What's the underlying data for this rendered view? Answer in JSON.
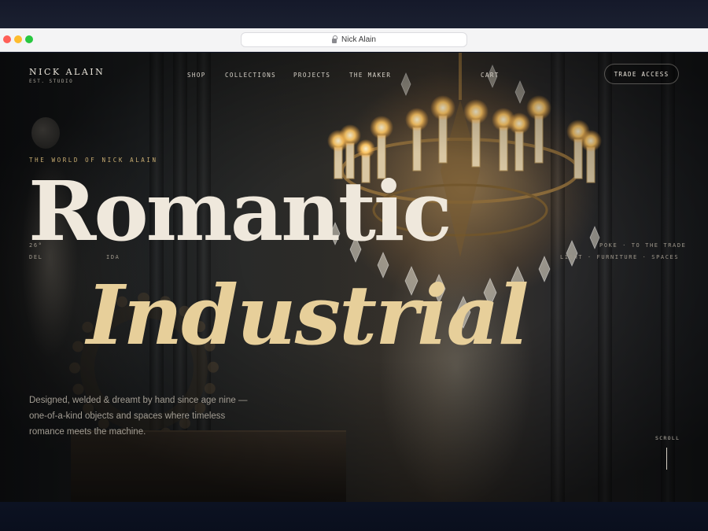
{
  "browser": {
    "address_text": "Nick Alain"
  },
  "brand": {
    "name": "NICK ALAIN",
    "tagline": "EST. STUDIO"
  },
  "nav": {
    "items": [
      {
        "label": "SHOP"
      },
      {
        "label": "COLLECTIONS"
      },
      {
        "label": "PROJECTS"
      },
      {
        "label": "THE MAKER"
      },
      {
        "label": "CART"
      }
    ],
    "trade_button": "TRADE ACCESS"
  },
  "hero": {
    "eyebrow": "THE WORLD OF NICK ALAIN",
    "headline_line1": "Romantic",
    "headline_line2": "Industrial",
    "meta_left_1": "26°",
    "meta_left_2": "DEL",
    "meta_left_3": "IDA",
    "meta_right_1": "POKE · TO THE TRADE",
    "meta_right_2": "LIGHT · FURNITURE · SPACES",
    "blurb": "Designed, welded & dreamt by hand since age nine — one-of-a-kind objects and spaces where timeless romance meets the machine.",
    "scroll_label": "SCROLL"
  },
  "colors": {
    "accent_gold": "#c9ad72",
    "headline_cream": "#efe8dc",
    "headline_gold": "#e7cf9a"
  }
}
